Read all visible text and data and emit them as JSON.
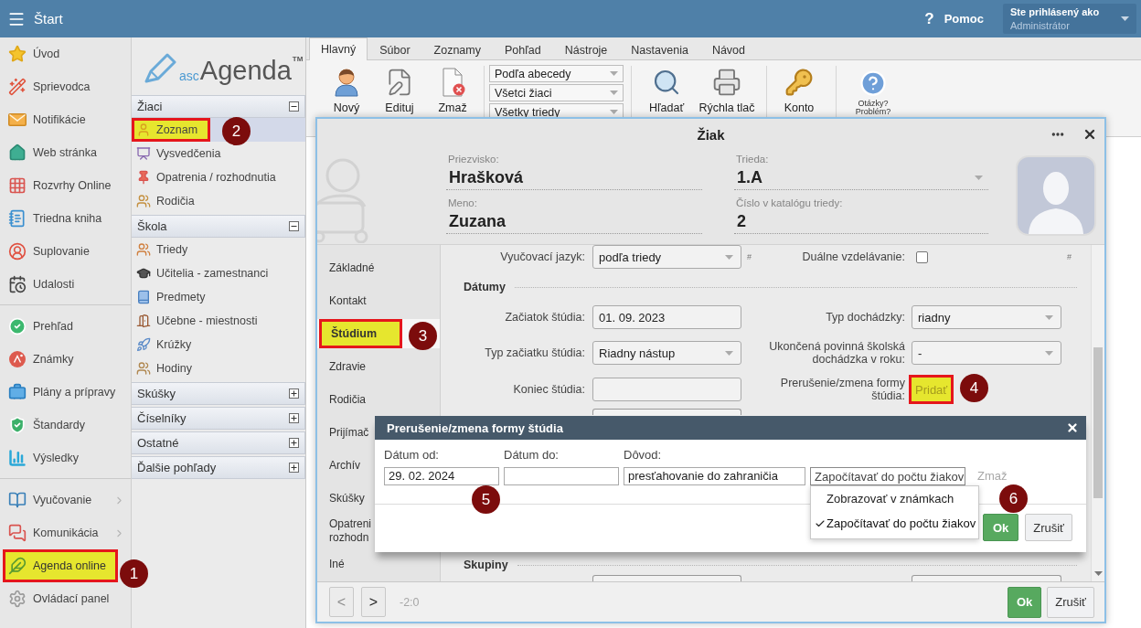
{
  "top_bar": {
    "title": "Štart",
    "help": {
      "glyph": "?",
      "label": "Pomoc"
    },
    "user": {
      "caption": "Ste prihlásený ako",
      "name": "Administrátor"
    }
  },
  "main_menu": {
    "groups": [
      [
        {
          "label": "Úvod",
          "submenu": false,
          "highlighted": false
        },
        {
          "label": "Sprievodca",
          "submenu": false,
          "highlighted": false
        },
        {
          "label": "Notifikácie",
          "submenu": false,
          "highlighted": false
        },
        {
          "label": "Web stránka",
          "submenu": false,
          "highlighted": false
        },
        {
          "label": "Rozvrhy Online",
          "submenu": false,
          "highlighted": false
        },
        {
          "label": "Triedna kniha",
          "submenu": false,
          "highlighted": false
        },
        {
          "label": "Suplovanie",
          "submenu": false,
          "highlighted": false
        },
        {
          "label": "Udalosti",
          "submenu": false,
          "highlighted": false
        }
      ],
      [
        {
          "label": "Prehľad",
          "submenu": false,
          "highlighted": false
        },
        {
          "label": "Známky",
          "submenu": false,
          "highlighted": false
        },
        {
          "label": "Plány a prípravy",
          "submenu": false,
          "highlighted": false
        },
        {
          "label": "Štandardy",
          "submenu": false,
          "highlighted": false
        },
        {
          "label": "Výsledky",
          "submenu": false,
          "highlighted": false
        }
      ],
      [
        {
          "label": "Vyučovanie",
          "submenu": true,
          "highlighted": false
        },
        {
          "label": "Komunikácia",
          "submenu": true,
          "highlighted": false
        },
        {
          "label": "Agenda online",
          "submenu": false,
          "highlighted": true,
          "callout": "1"
        },
        {
          "label": "Ovládací panel",
          "submenu": false,
          "highlighted": false
        }
      ]
    ]
  },
  "agenda_nav": {
    "logo": {
      "prefix": "asc",
      "name": "Agenda",
      "trademark": "TM"
    },
    "sections": [
      {
        "title": "Žiaci",
        "expanded": true,
        "items": [
          {
            "label": "Zoznam",
            "selected": true,
            "highlighted": true,
            "callout": "2"
          },
          {
            "label": "Vysvedčenia",
            "selected": false,
            "highlighted": false
          },
          {
            "label": "Opatrenia / rozhodnutia",
            "selected": false,
            "highlighted": false
          },
          {
            "label": "Rodičia",
            "selected": false,
            "highlighted": false
          }
        ]
      },
      {
        "title": "Škola",
        "expanded": true,
        "items": [
          {
            "label": "Triedy",
            "selected": false,
            "highlighted": false
          },
          {
            "label": "Učitelia - zamestnanci",
            "selected": false,
            "highlighted": false
          },
          {
            "label": "Predmety",
            "selected": false,
            "highlighted": false
          },
          {
            "label": "Učebne - miestnosti",
            "selected": false,
            "highlighted": false
          },
          {
            "label": "Krúžky",
            "selected": false,
            "highlighted": false
          },
          {
            "label": "Hodiny",
            "selected": false,
            "highlighted": false
          }
        ]
      },
      {
        "title": "Skúšky",
        "expanded": false
      },
      {
        "title": "Číselníky",
        "expanded": false
      },
      {
        "title": "Ostatné",
        "expanded": false
      },
      {
        "title": "Ďalšie pohľady",
        "expanded": false
      }
    ]
  },
  "ribbon": {
    "tabs": [
      {
        "label": "Hlavný",
        "selected": true
      },
      {
        "label": "Súbor",
        "selected": false
      },
      {
        "label": "Zoznamy",
        "selected": false
      },
      {
        "label": "Pohľad",
        "selected": false
      },
      {
        "label": "Nástroje",
        "selected": false
      },
      {
        "label": "Nastavenia",
        "selected": false
      },
      {
        "label": "Návod",
        "selected": false
      }
    ],
    "groups": [
      {
        "kind": "buttons",
        "buttons": [
          "Nový",
          "Edituj",
          "Zmaž"
        ]
      },
      {
        "kind": "selects",
        "selects": [
          "Podľa abecedy",
          "Všetci žiaci",
          "Všetky triedy"
        ]
      },
      {
        "kind": "buttons",
        "buttons": [
          "Hľadať",
          "Rýchla tlač"
        ]
      },
      {
        "kind": "buttons",
        "buttons": [
          "Konto"
        ]
      },
      {
        "kind": "help",
        "buttons": [
          "Otázky? Problém?"
        ]
      }
    ]
  },
  "student_dialog": {
    "title": "Žiak",
    "header_fields": [
      {
        "kind": "text",
        "label": "Priezvisko:",
        "value": "Hrašková"
      },
      {
        "kind": "select",
        "label": "Trieda:",
        "value": "1.A"
      },
      {
        "kind": "text",
        "label": "Meno:",
        "value": "Zuzana"
      },
      {
        "kind": "text",
        "label": "Číslo v katalógu triedy:",
        "value": "2"
      }
    ],
    "nav": [
      {
        "label": "Základné",
        "selected": false,
        "highlighted": false
      },
      {
        "label": "Kontakt",
        "selected": false,
        "highlighted": false
      },
      {
        "label": "Štúdium",
        "selected": true,
        "highlighted": true,
        "callout": "3"
      },
      {
        "label": "Zdravie",
        "selected": false,
        "highlighted": false
      },
      {
        "label": "Rodičia",
        "selected": false,
        "highlighted": false
      },
      {
        "label": "Prijímač",
        "selected": false,
        "highlighted": false
      },
      {
        "label": "Archív",
        "selected": false,
        "highlighted": false
      },
      {
        "label": "Skúšky",
        "selected": false,
        "highlighted": false
      },
      {
        "label": "Opatreni rozhodn",
        "selected": false,
        "highlighted": false
      },
      {
        "label": "Iné",
        "selected": false,
        "highlighted": false
      }
    ],
    "form": [
      {
        "kind": "pair",
        "left": {
          "label": "Vyučovací jazyk:",
          "control": {
            "kind": "select",
            "value": "podľa triedy"
          },
          "hash": "#"
        },
        "right": {
          "label": "Duálne vzdelávanie:",
          "control": {
            "kind": "checkbox",
            "checked": false
          },
          "hash": "#"
        }
      },
      {
        "kind": "section",
        "title": "Dátumy"
      },
      {
        "kind": "pair",
        "left": {
          "label": "Začiatok štúdia:",
          "control": {
            "kind": "input",
            "value": "01. 09. 2023"
          }
        },
        "right": {
          "label": "Typ dochádzky:",
          "control": {
            "kind": "select",
            "value": "riadny"
          }
        }
      },
      {
        "kind": "pair",
        "left": {
          "label": "Typ začiatku štúdia:",
          "control": {
            "kind": "select",
            "value": "Riadny nástup"
          }
        },
        "right": {
          "label": "Ukončená povinná školská dochádzka v roku:",
          "control": {
            "kind": "select",
            "value": "-"
          }
        }
      },
      {
        "kind": "pair",
        "left": {
          "label": "Koniec štúdia:",
          "control": {
            "kind": "input"
          }
        },
        "right": {
          "label": "Prerušenie/zmena formy štúdia:",
          "control": {
            "kind": "link",
            "text": "Pridať",
            "highlighted": true,
            "callout": "4"
          }
        }
      },
      {
        "kind": "pair_cut",
        "left": {
          "control": {
            "kind": "input"
          }
        }
      },
      {
        "kind": "section",
        "title": "Skupiny"
      },
      {
        "kind": "pair_cut",
        "left": {
          "control": {
            "kind": "input"
          }
        },
        "right": {
          "control": {
            "kind": "input"
          }
        }
      }
    ],
    "pager": {
      "prev": {
        "glyph": "<",
        "disabled": true
      },
      "next": {
        "glyph": ">",
        "disabled": false
      },
      "position": "-2:0"
    },
    "buttons": [
      {
        "label": "Ok",
        "kind": "primary"
      },
      {
        "label": "Zrušiť",
        "kind": "secondary"
      }
    ]
  },
  "interruption_dialog": {
    "title": "Prerušenie/zmena formy štúdia",
    "fields": [
      {
        "label": "Dátum od:",
        "value": "29. 02. 2024",
        "callout": "5"
      },
      {
        "label": "Dátum do:"
      },
      {
        "label": "Dôvod:",
        "value": "presťahovanie do zahraničia"
      }
    ],
    "mode_select": {
      "value": "Započítavať do počtu žiakov",
      "expanded": true,
      "options": [
        {
          "label": "Zobrazovať v známkach",
          "selected": false
        },
        {
          "label": "Započítavať do počtu žiakov",
          "selected": true
        }
      ]
    },
    "delete": "Zmaž",
    "buttons": [
      {
        "label": "Ok",
        "kind": "primary",
        "callout": "6"
      },
      {
        "label": "Zrušiť",
        "kind": "secondary"
      }
    ]
  }
}
